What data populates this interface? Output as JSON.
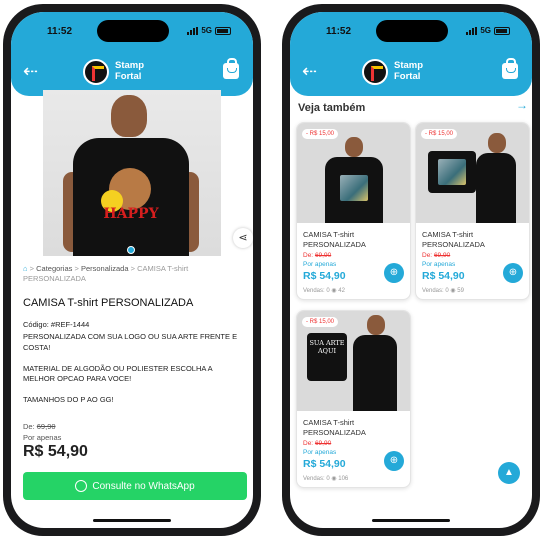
{
  "status": {
    "time": "11:52",
    "network": "5G"
  },
  "header": {
    "brand_line1": "Stamp",
    "brand_line2": "Fortal"
  },
  "product": {
    "breadcrumb": {
      "sep": ">",
      "item1": "Categorias",
      "item2": "Personalizada",
      "current": "CAMISA T-shirt PERSONALIZADA"
    },
    "title": "CAMISA T-shirt PERSONALIZADA",
    "code": "Código: #REF-1444",
    "description": [
      "PERSONALIZADA COM SUA LOGO OU SUA ARTE FRENTE E COSTA!",
      "MATERIAL DE ALGODÃO OU POLIESTER ESCOLHA A MELHOR OPCAO PARA VOCE!",
      "TAMANHOS DO P AO GG!"
    ],
    "old_price_label": "De:",
    "old_price": "69,90",
    "por_apenas": "Por apenas",
    "price": "R$ 54,90",
    "shirt_print": "HAPPY",
    "whatsapp_label": "Consulte no WhatsApp"
  },
  "related": {
    "title": "Veja também",
    "items": [
      {
        "tag": "- R$ 15,00",
        "name": "CAMISA T-shirt PERSONALIZADA",
        "de_label": "De:",
        "old_price": "69,90",
        "por_apenas": "Por apenas",
        "price": "R$ 54,90",
        "stats": "Vendas: 0  ◉ 42"
      },
      {
        "tag": "- R$ 15,00",
        "name": "CAMISA T-shirt PERSONALIZADA",
        "de_label": "De:",
        "old_price": "69,90",
        "por_apenas": "Por apenas",
        "price": "R$ 54,90",
        "stats": "Vendas: 0  ◉ 59"
      },
      {
        "tag": "- R$ 15,00",
        "name": "CAMISA T-shirt PERSONALIZADA",
        "de_label": "De:",
        "old_price": "69,90",
        "por_apenas": "Por apenas",
        "price": "R$ 54,90",
        "stats": "Vendas: 0  ◉ 106",
        "shirt_print": "SUA ARTE AQUI"
      }
    ]
  },
  "colors": {
    "accent": "#24a9d8",
    "whatsapp": "#25d366",
    "discount": "#e33333"
  },
  "icons": {
    "back": "arrow-left-icon",
    "bag": "shopping-bag-icon",
    "share": "share-icon",
    "cart": "cart-plus-icon",
    "top": "chevron-up-icon"
  }
}
